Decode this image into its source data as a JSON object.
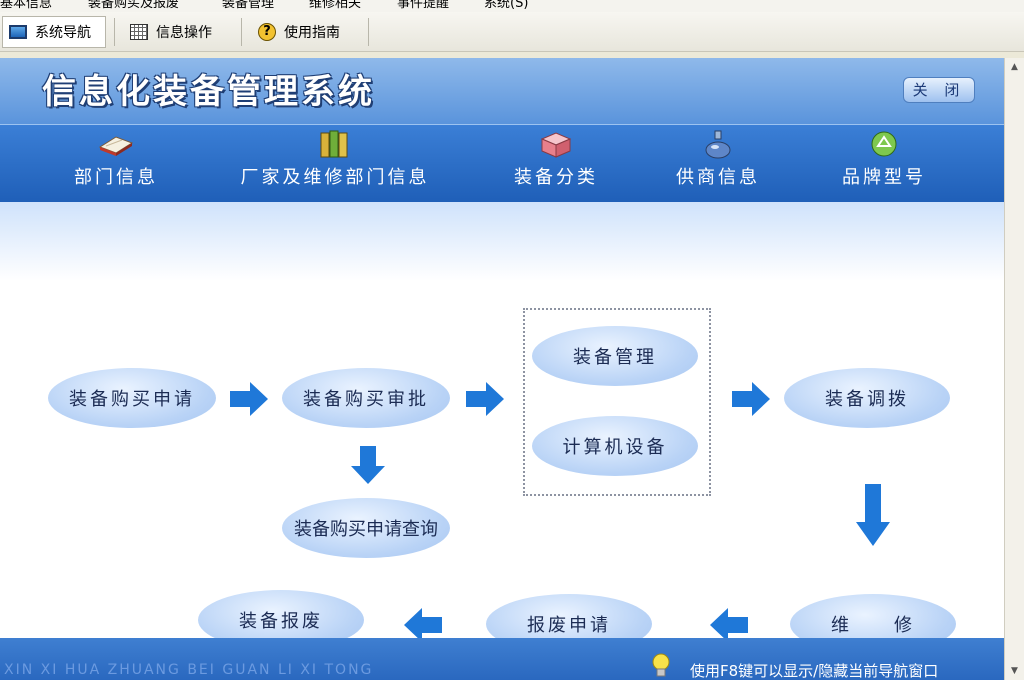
{
  "menubar": {
    "items": [
      "基本信息",
      "装备购买及报废",
      "装备管理",
      "维修相关",
      "事件提醒",
      "系统(S)"
    ]
  },
  "toolbar": {
    "nav_label": "系统导航",
    "ops_label": "信息操作",
    "guide_label": "使用指南"
  },
  "header": {
    "title": "信息化装备管理系统",
    "close_label": "关 闭"
  },
  "categories": [
    {
      "label": "部门信息",
      "icon": "book-icon"
    },
    {
      "label": "厂家及维修部门信息",
      "icon": "binders-icon"
    },
    {
      "label": "装备分类",
      "icon": "box-icon"
    },
    {
      "label": "供商信息",
      "icon": "flask-icon"
    },
    {
      "label": "品牌型号",
      "icon": "recycle-icon"
    }
  ],
  "flow": {
    "purchase_request": "装备购买申请",
    "purchase_approval": "装备购买审批",
    "equipment_management": "装备管理",
    "computer_equipment": "计算机设备",
    "equipment_transfer": "装备调拨",
    "purchase_query": "装备购买申请查询",
    "repair": "维　　修",
    "scrap_request": "报废申请",
    "scrap": "装备报废"
  },
  "footer": {
    "pinyin": "XIN XI HUA ZHUANG BEI GUAN LI XI TONG",
    "hint": "使用F8键可以显示/隐藏当前导航窗口"
  },
  "colors": {
    "header_blue": "#5a94dc",
    "catbar_blue": "#1f5fb8",
    "node_fill": "#b9d3f6",
    "arrow_blue": "#1f78d8"
  }
}
